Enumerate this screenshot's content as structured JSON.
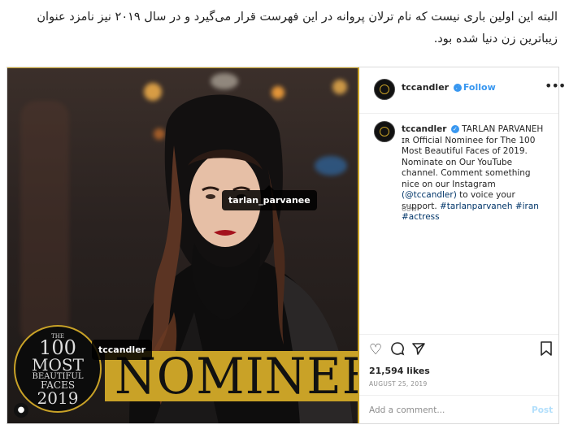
{
  "article": {
    "text": "البته این اولین باری نیست که نام ترلان پروانه در این فهرست قرار می‌گیرد و در سال ۲۰۱۹ نیز نامزد عنوان زیباترین زن دنیا شده بود."
  },
  "post": {
    "image": {
      "tag_person": "tarlan_parvanee",
      "tag_brand": "tccandler",
      "banner": "NOMINEE",
      "badge": {
        "the": "THE",
        "number": "100",
        "most": "MOST",
        "beautiful": "BEAUTIFUL",
        "faces": "FACES",
        "year": "2019"
      },
      "user_tags_icon": "person-icon"
    },
    "header": {
      "username": "tccandler",
      "verified_icon": "verified-check-icon",
      "follow": "• Follow",
      "more_icon": "more-horizontal-icon"
    },
    "caption": {
      "username": "tccandler",
      "body": "TARLAN PARVANEH ɪʀ Official Nominee for The 100 Most Beautiful Faces of 2019. Nominate on Our YouTube channel. Comment something nice on our Instagram",
      "mention": "(@tccandler)",
      "body2": "to voice your support.",
      "hashtags": "#tarlanparvaneh #iran #actress",
      "time": "68w"
    },
    "actions": {
      "like_icon": "heart-icon",
      "comment_icon": "comment-icon",
      "share_icon": "share-icon",
      "save_icon": "bookmark-icon",
      "likes": "21,594 likes",
      "date": "AUGUST 25, 2019"
    },
    "comment": {
      "placeholder": "Add a comment...",
      "post": "Post"
    },
    "colors": {
      "accent_gold": "#c9a227",
      "link_blue": "#3897f0"
    }
  }
}
